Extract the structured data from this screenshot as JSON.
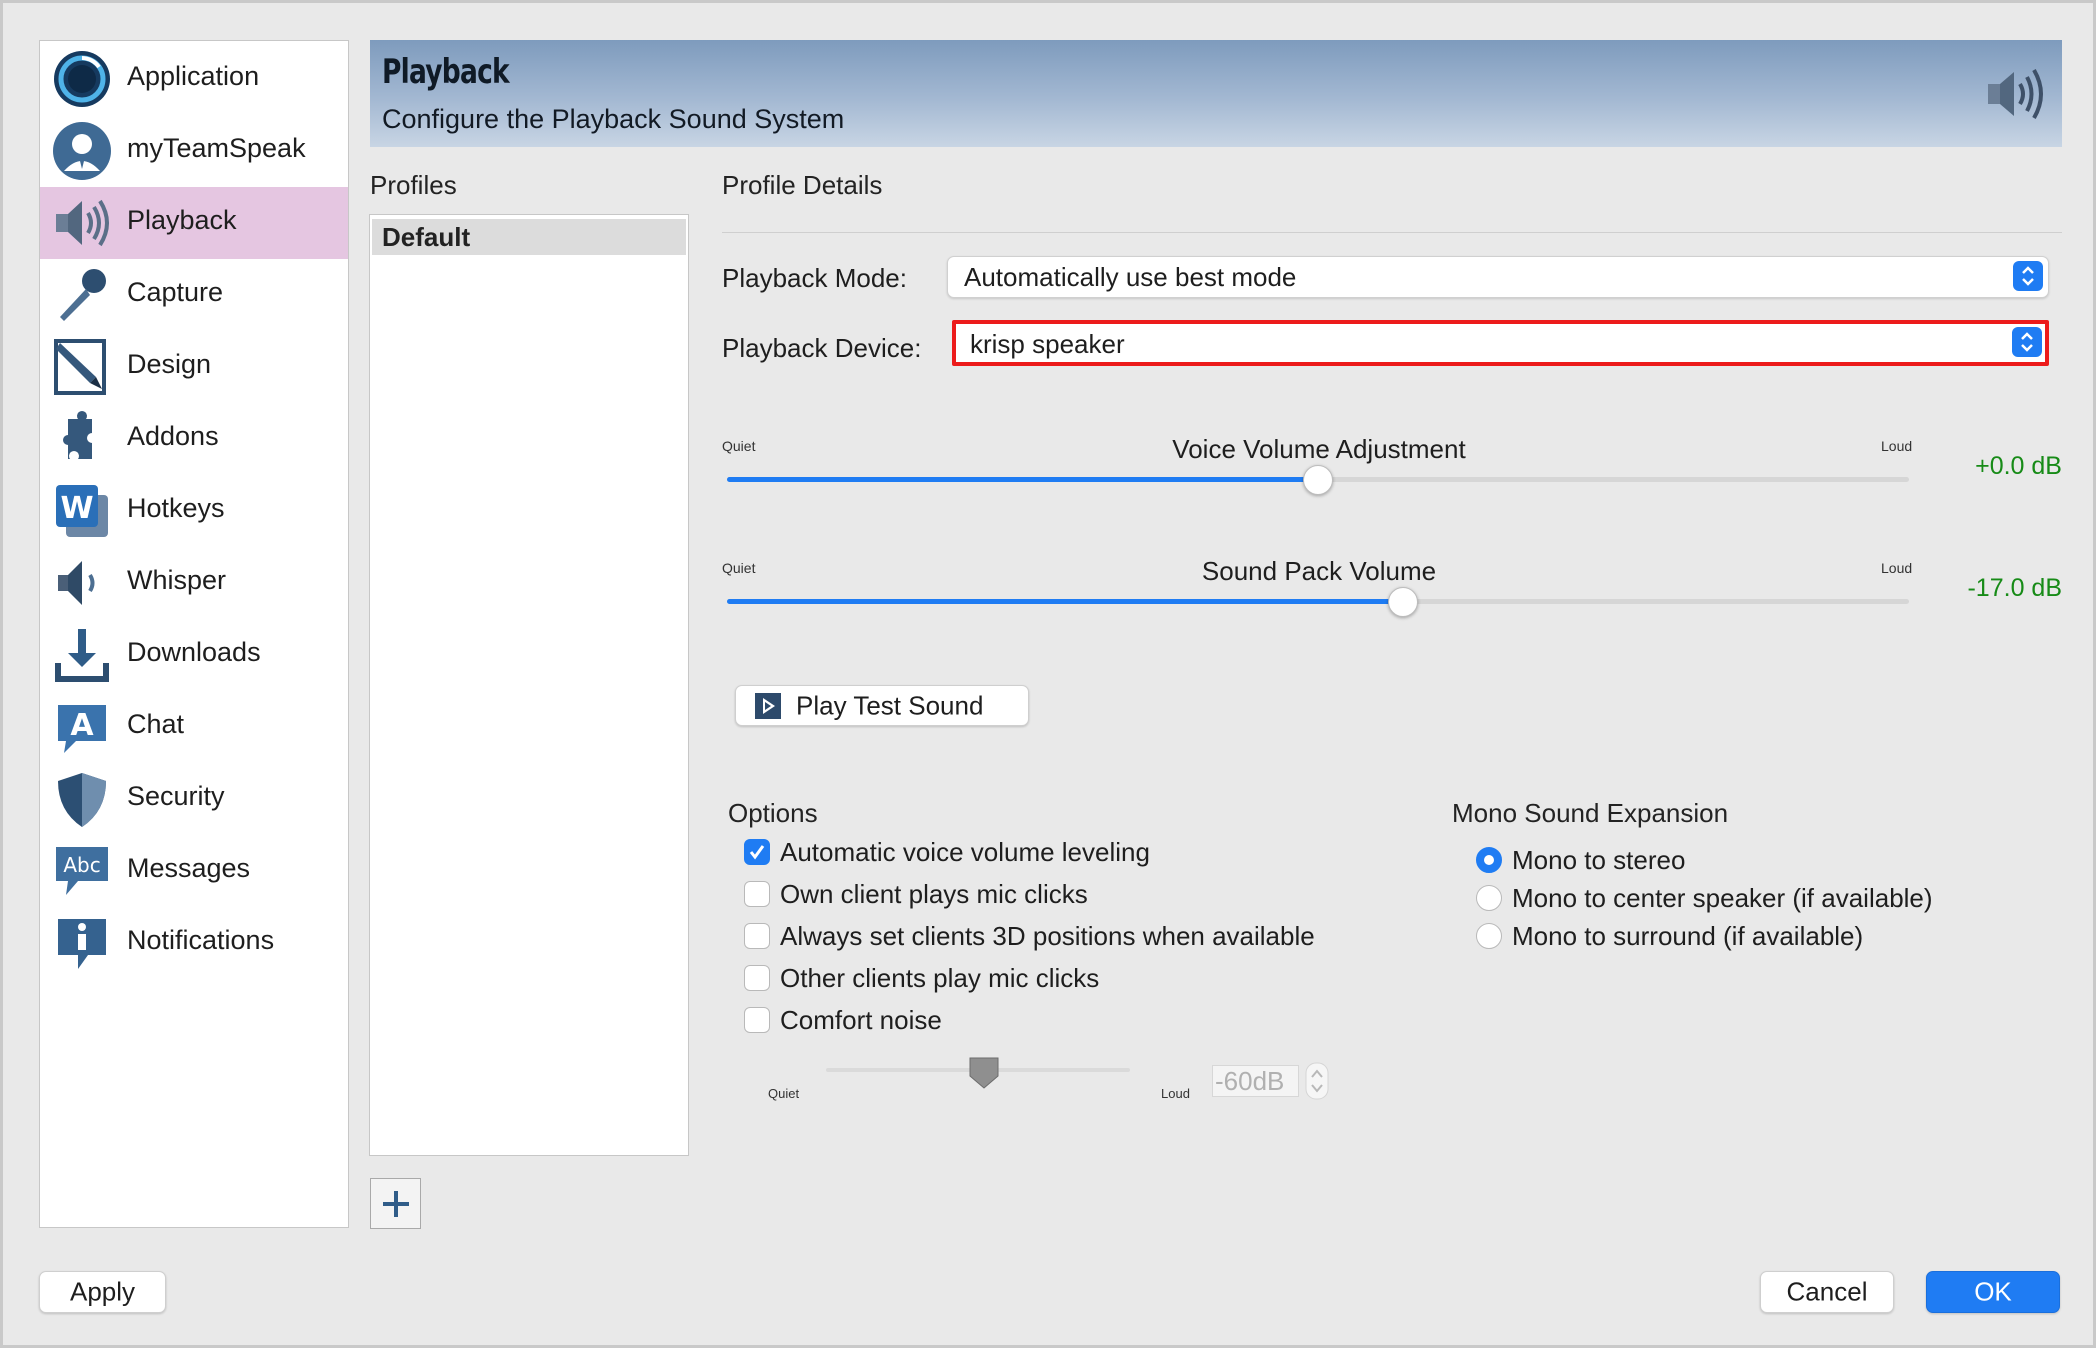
{
  "sidebar": {
    "items": [
      {
        "label": "Application",
        "icon": "application-icon"
      },
      {
        "label": "myTeamSpeak",
        "icon": "user-avatar-icon"
      },
      {
        "label": "Playback",
        "icon": "speaker-icon",
        "selected": true
      },
      {
        "label": "Capture",
        "icon": "microphone-icon"
      },
      {
        "label": "Design",
        "icon": "pencil-icon"
      },
      {
        "label": "Addons",
        "icon": "puzzle-icon"
      },
      {
        "label": "Hotkeys",
        "icon": "w-key-icon"
      },
      {
        "label": "Whisper",
        "icon": "whisper-speaker-icon"
      },
      {
        "label": "Downloads",
        "icon": "download-icon"
      },
      {
        "label": "Chat",
        "icon": "chat-bubble-a-icon"
      },
      {
        "label": "Security",
        "icon": "shield-icon"
      },
      {
        "label": "Messages",
        "icon": "abc-bubble-icon"
      },
      {
        "label": "Notifications",
        "icon": "info-bubble-icon"
      }
    ]
  },
  "header": {
    "title": "Playback",
    "subtitle": "Configure the Playback Sound System",
    "icon": "speaker-icon"
  },
  "profiles": {
    "label": "Profiles",
    "items": [
      "Default"
    ],
    "add_icon": "plus-icon"
  },
  "details": {
    "label": "Profile Details",
    "playback_mode": {
      "label": "Playback Mode:",
      "value": "Automatically use best mode"
    },
    "playback_device": {
      "label": "Playback Device:",
      "value": "krisp speaker"
    },
    "voice_volume": {
      "title": "Voice Volume Adjustment",
      "min_label": "Quiet",
      "max_label": "Loud",
      "value_text": "+0.0 dB",
      "fraction": 0.5
    },
    "sound_pack_volume": {
      "title": "Sound Pack Volume",
      "min_label": "Quiet",
      "max_label": "Loud",
      "value_text": "-17.0 dB",
      "fraction": 0.572
    },
    "test_button": {
      "label": "Play Test Sound",
      "icon": "play-icon"
    }
  },
  "options": {
    "title": "Options",
    "items": [
      {
        "label": "Automatic voice volume leveling",
        "checked": true
      },
      {
        "label": "Own client plays mic clicks",
        "checked": false
      },
      {
        "label": "Always set clients 3D positions when available",
        "checked": false
      },
      {
        "label": "Other clients play mic clicks",
        "checked": false
      },
      {
        "label": "Comfort noise",
        "checked": false
      }
    ],
    "comfort_noise": {
      "min_label": "Quiet",
      "max_label": "Loud",
      "value": "-60dB",
      "fraction": 0.52
    }
  },
  "mono_expansion": {
    "title": "Mono Sound Expansion",
    "items": [
      {
        "label": "Mono to stereo",
        "selected": true
      },
      {
        "label": "Mono to center speaker (if available)",
        "selected": false
      },
      {
        "label": "Mono to surround (if available)",
        "selected": false
      }
    ]
  },
  "footer": {
    "apply_label": "Apply",
    "cancel_label": "Cancel",
    "ok_label": "OK"
  },
  "colors": {
    "accent": "#1f7cf3",
    "selected_sidebar": "#e5c6e1",
    "db_value": "#178b17",
    "highlight": "#ec1b1b"
  }
}
